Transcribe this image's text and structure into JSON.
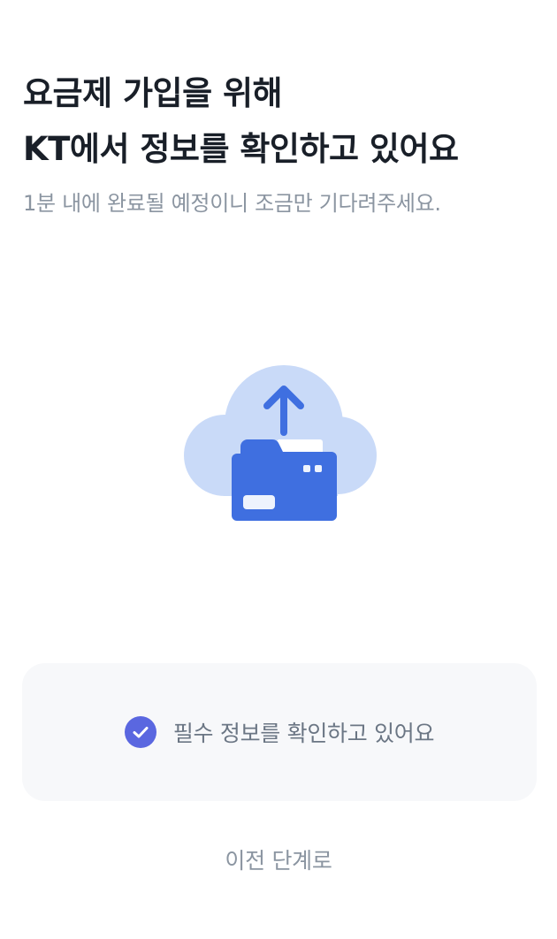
{
  "header": {
    "title_line1": "요금제 가입을 위해",
    "title_line2": "KT에서 정보를 확인하고 있어요",
    "subtitle": "1분 내에 완료될 예정이니 조금만 기다려주세요."
  },
  "illustration": {
    "icon": "cloud-upload-folder-icon",
    "colors": {
      "cloud": "#c9daf8",
      "folder": "#3f6fe0",
      "arrow": "#3f6fe0"
    }
  },
  "status": {
    "icon": "check-circle-icon",
    "icon_color": "#5a67e0",
    "text": "필수 정보를 확인하고 있어요"
  },
  "footer": {
    "back_label": "이전 단계로"
  }
}
